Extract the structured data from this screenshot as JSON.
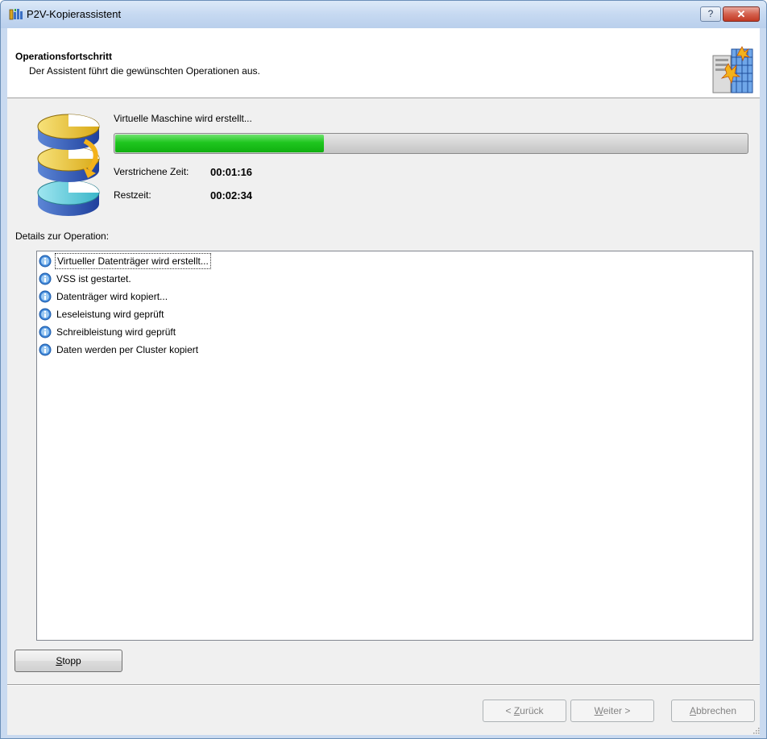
{
  "window": {
    "title": "P2V-Kopierassistent",
    "help_label": "?",
    "close_label": "✕"
  },
  "header": {
    "title": "Operationsfortschritt",
    "subtitle": "Der Assistent führt die gewünschten Operationen aus."
  },
  "progress": {
    "status_text": "Virtuelle Maschine wird erstellt...",
    "fraction": 0.33,
    "accent_color": "#1fc61f"
  },
  "timing": {
    "elapsed_label": "Verstrichene Zeit:",
    "elapsed_value": "00:01:16",
    "remaining_label": "Restzeit:",
    "remaining_value": "00:02:34"
  },
  "details": {
    "label": "Details zur Operation:",
    "items": [
      {
        "icon": "info-icon",
        "text": "Virtueller Datenträger wird erstellt..."
      },
      {
        "icon": "info-icon",
        "text": "VSS ist gestartet."
      },
      {
        "icon": "info-icon",
        "text": "Datenträger wird kopiert..."
      },
      {
        "icon": "info-icon",
        "text": "Leseleistung wird geprüft"
      },
      {
        "icon": "info-icon",
        "text": "Schreibleistung wird geprüft"
      },
      {
        "icon": "info-icon",
        "text": "Daten werden per Cluster kopiert"
      }
    ]
  },
  "buttons": {
    "stop": {
      "mnemonic": "S",
      "rest": "topp"
    },
    "back": {
      "prefix": "< ",
      "mnemonic": "Z",
      "rest": "urück",
      "enabled": false
    },
    "next": {
      "mnemonic": "W",
      "rest": "eiter >",
      "enabled": false
    },
    "cancel": {
      "mnemonic": "A",
      "rest": "bbrechen",
      "enabled": false
    }
  }
}
